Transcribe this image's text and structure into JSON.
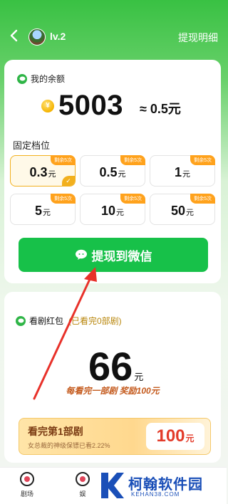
{
  "header": {
    "level": "lv.2",
    "withdraw_detail": "提现明细"
  },
  "balance": {
    "title": "我的余额",
    "coin_symbol": "¥",
    "coins": "5003",
    "approx": "≈ 0.5元"
  },
  "tiers": {
    "label": "固定档位",
    "items": [
      {
        "badge": "剩余5次",
        "amount": "0.3",
        "unit": "元",
        "selected": true
      },
      {
        "badge": "剩余5次",
        "amount": "0.5",
        "unit": "元",
        "selected": false
      },
      {
        "badge": "剩余5次",
        "amount": "1",
        "unit": "元",
        "selected": false
      },
      {
        "badge": "剩余5次",
        "amount": "5",
        "unit": "元",
        "selected": false
      },
      {
        "badge": "剩余5次",
        "amount": "10",
        "unit": "元",
        "selected": false
      },
      {
        "badge": "剩余5次",
        "amount": "50",
        "unit": "元",
        "selected": false
      }
    ]
  },
  "withdraw_button": "提现到微信",
  "drama": {
    "title": "看剧红包",
    "watched": "(已看完0部剧)",
    "amount": "66",
    "unit": "元",
    "reward_line": "每看完一部剧 奖励100元",
    "task": {
      "title": "看完第1部剧",
      "subtitle": "女总裁的神级保镖已看2.22%",
      "reward": "100",
      "reward_unit": "元"
    }
  },
  "bottom_nav": {
    "items": [
      {
        "label": "剧场"
      },
      {
        "label": "娱"
      }
    ]
  },
  "watermark": {
    "text": "柯翰软件园",
    "url": "KEHAN38.COM"
  },
  "colors": {
    "brand_green": "#17c149",
    "tier_selected": "#f2b01e",
    "badge_orange": "#ffa21c",
    "reward_red": "#e33b2a"
  }
}
